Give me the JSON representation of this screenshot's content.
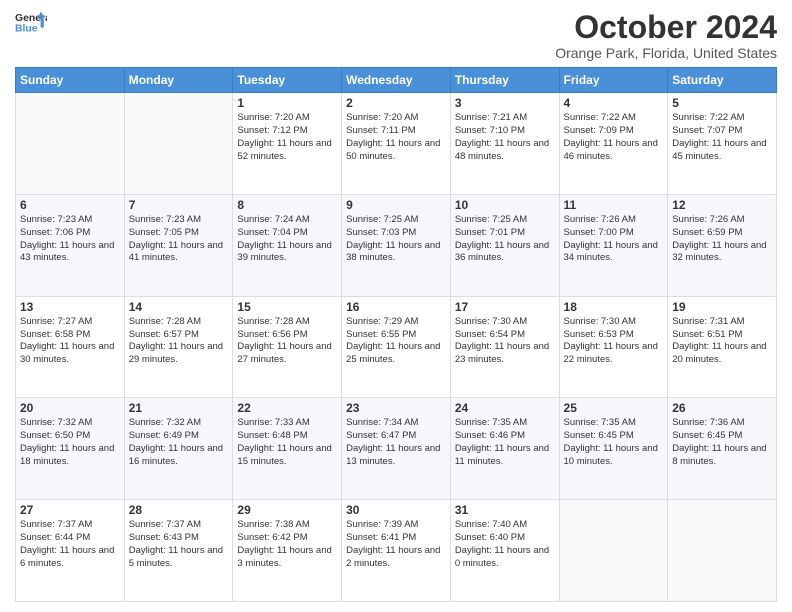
{
  "header": {
    "logo_line1": "General",
    "logo_line2": "Blue",
    "title": "October 2024",
    "subtitle": "Orange Park, Florida, United States"
  },
  "weekdays": [
    "Sunday",
    "Monday",
    "Tuesday",
    "Wednesday",
    "Thursday",
    "Friday",
    "Saturday"
  ],
  "rows": [
    [
      {
        "day": "",
        "info": ""
      },
      {
        "day": "",
        "info": ""
      },
      {
        "day": "1",
        "info": "Sunrise: 7:20 AM\nSunset: 7:12 PM\nDaylight: 11 hours and 52 minutes."
      },
      {
        "day": "2",
        "info": "Sunrise: 7:20 AM\nSunset: 7:11 PM\nDaylight: 11 hours and 50 minutes."
      },
      {
        "day": "3",
        "info": "Sunrise: 7:21 AM\nSunset: 7:10 PM\nDaylight: 11 hours and 48 minutes."
      },
      {
        "day": "4",
        "info": "Sunrise: 7:22 AM\nSunset: 7:09 PM\nDaylight: 11 hours and 46 minutes."
      },
      {
        "day": "5",
        "info": "Sunrise: 7:22 AM\nSunset: 7:07 PM\nDaylight: 11 hours and 45 minutes."
      }
    ],
    [
      {
        "day": "6",
        "info": "Sunrise: 7:23 AM\nSunset: 7:06 PM\nDaylight: 11 hours and 43 minutes."
      },
      {
        "day": "7",
        "info": "Sunrise: 7:23 AM\nSunset: 7:05 PM\nDaylight: 11 hours and 41 minutes."
      },
      {
        "day": "8",
        "info": "Sunrise: 7:24 AM\nSunset: 7:04 PM\nDaylight: 11 hours and 39 minutes."
      },
      {
        "day": "9",
        "info": "Sunrise: 7:25 AM\nSunset: 7:03 PM\nDaylight: 11 hours and 38 minutes."
      },
      {
        "day": "10",
        "info": "Sunrise: 7:25 AM\nSunset: 7:01 PM\nDaylight: 11 hours and 36 minutes."
      },
      {
        "day": "11",
        "info": "Sunrise: 7:26 AM\nSunset: 7:00 PM\nDaylight: 11 hours and 34 minutes."
      },
      {
        "day": "12",
        "info": "Sunrise: 7:26 AM\nSunset: 6:59 PM\nDaylight: 11 hours and 32 minutes."
      }
    ],
    [
      {
        "day": "13",
        "info": "Sunrise: 7:27 AM\nSunset: 6:58 PM\nDaylight: 11 hours and 30 minutes."
      },
      {
        "day": "14",
        "info": "Sunrise: 7:28 AM\nSunset: 6:57 PM\nDaylight: 11 hours and 29 minutes."
      },
      {
        "day": "15",
        "info": "Sunrise: 7:28 AM\nSunset: 6:56 PM\nDaylight: 11 hours and 27 minutes."
      },
      {
        "day": "16",
        "info": "Sunrise: 7:29 AM\nSunset: 6:55 PM\nDaylight: 11 hours and 25 minutes."
      },
      {
        "day": "17",
        "info": "Sunrise: 7:30 AM\nSunset: 6:54 PM\nDaylight: 11 hours and 23 minutes."
      },
      {
        "day": "18",
        "info": "Sunrise: 7:30 AM\nSunset: 6:53 PM\nDaylight: 11 hours and 22 minutes."
      },
      {
        "day": "19",
        "info": "Sunrise: 7:31 AM\nSunset: 6:51 PM\nDaylight: 11 hours and 20 minutes."
      }
    ],
    [
      {
        "day": "20",
        "info": "Sunrise: 7:32 AM\nSunset: 6:50 PM\nDaylight: 11 hours and 18 minutes."
      },
      {
        "day": "21",
        "info": "Sunrise: 7:32 AM\nSunset: 6:49 PM\nDaylight: 11 hours and 16 minutes."
      },
      {
        "day": "22",
        "info": "Sunrise: 7:33 AM\nSunset: 6:48 PM\nDaylight: 11 hours and 15 minutes."
      },
      {
        "day": "23",
        "info": "Sunrise: 7:34 AM\nSunset: 6:47 PM\nDaylight: 11 hours and 13 minutes."
      },
      {
        "day": "24",
        "info": "Sunrise: 7:35 AM\nSunset: 6:46 PM\nDaylight: 11 hours and 11 minutes."
      },
      {
        "day": "25",
        "info": "Sunrise: 7:35 AM\nSunset: 6:45 PM\nDaylight: 11 hours and 10 minutes."
      },
      {
        "day": "26",
        "info": "Sunrise: 7:36 AM\nSunset: 6:45 PM\nDaylight: 11 hours and 8 minutes."
      }
    ],
    [
      {
        "day": "27",
        "info": "Sunrise: 7:37 AM\nSunset: 6:44 PM\nDaylight: 11 hours and 6 minutes."
      },
      {
        "day": "28",
        "info": "Sunrise: 7:37 AM\nSunset: 6:43 PM\nDaylight: 11 hours and 5 minutes."
      },
      {
        "day": "29",
        "info": "Sunrise: 7:38 AM\nSunset: 6:42 PM\nDaylight: 11 hours and 3 minutes."
      },
      {
        "day": "30",
        "info": "Sunrise: 7:39 AM\nSunset: 6:41 PM\nDaylight: 11 hours and 2 minutes."
      },
      {
        "day": "31",
        "info": "Sunrise: 7:40 AM\nSunset: 6:40 PM\nDaylight: 11 hours and 0 minutes."
      },
      {
        "day": "",
        "info": ""
      },
      {
        "day": "",
        "info": ""
      }
    ]
  ]
}
